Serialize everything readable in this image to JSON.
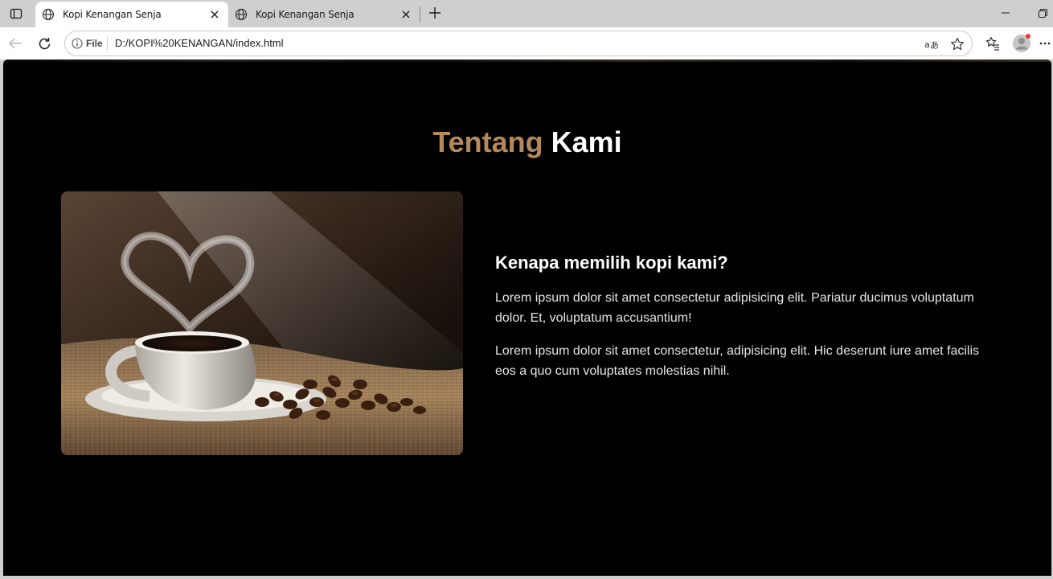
{
  "browser": {
    "tabs": [
      {
        "title": "Kopi Kenangan Senja",
        "active": true
      },
      {
        "title": "Kopi Kenangan Senja",
        "active": false
      }
    ],
    "address": {
      "scheme_label": "File",
      "url": "D:/KOPI%20KENANGAN/index.html"
    }
  },
  "about": {
    "title_accent": "Tentang",
    "title_rest": "Kami",
    "heading": "Kenapa memilih kopi kami?",
    "paragraphs": [
      "Lorem ipsum dolor sit amet consectetur adipisicing elit. Pariatur ducimus voluptatum dolor. Et, voluptatum accusantium!",
      "Lorem ipsum dolor sit amet consectetur, adipisicing elit. Hic deserunt iure amet facilis eos a quo cum voluptates molestias nihil."
    ]
  },
  "colors": {
    "accent": "#b6895b",
    "page_bg": "#000000",
    "chrome_bg": "#cfcfcf"
  },
  "icons": [
    "tab-actions-icon",
    "globe-icon",
    "close-icon",
    "plus-icon",
    "minimize-icon",
    "restore-icon",
    "back-icon",
    "refresh-icon",
    "info-icon",
    "read-aloud-icon",
    "star-icon",
    "favorites-icon",
    "profile-icon",
    "more-icon"
  ]
}
